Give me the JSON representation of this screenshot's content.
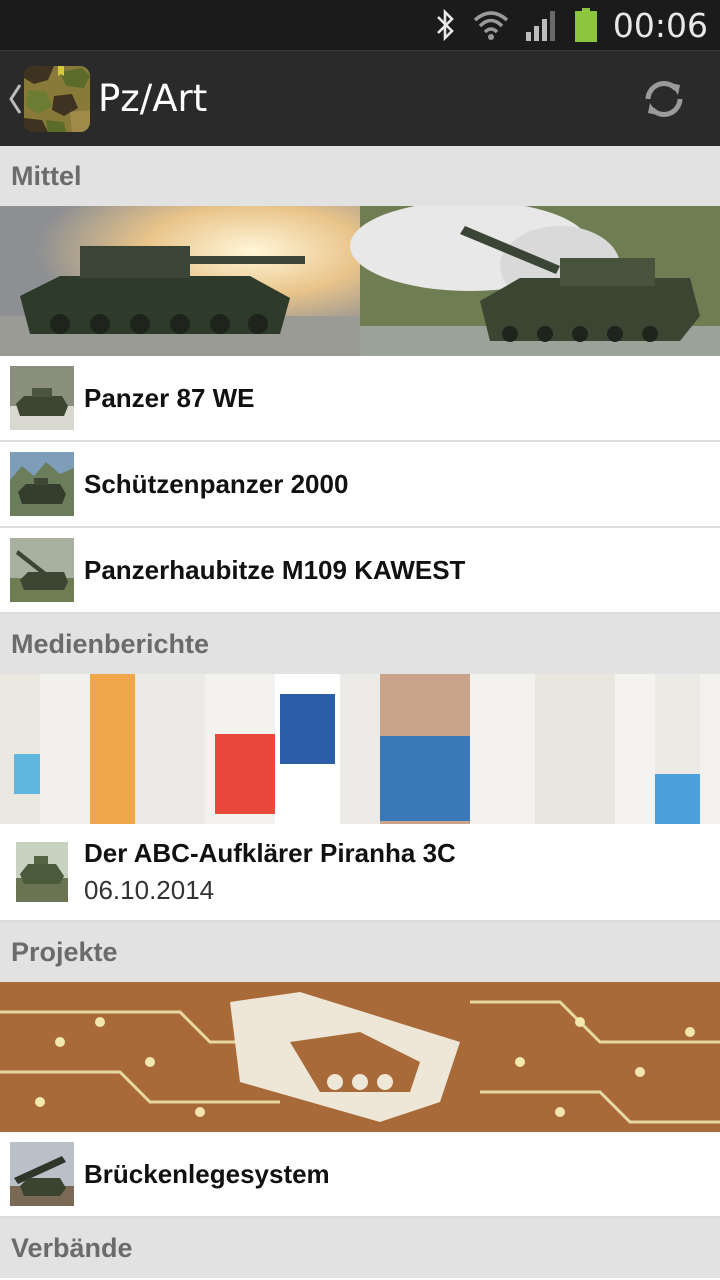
{
  "status_bar": {
    "time": "00:06",
    "icons": [
      "bluetooth-icon",
      "wifi-icon",
      "signal-icon",
      "battery-icon"
    ],
    "battery_color": "#8cc63f"
  },
  "action_bar": {
    "title": "Pz/Art",
    "icons": [
      "back-caret-icon",
      "app-camo-icon",
      "refresh-icon"
    ]
  },
  "sections": [
    {
      "header": "Mittel",
      "banner": "tanks-banner-image",
      "items": [
        {
          "title": "Panzer 87 WE",
          "thumb": "tank-thumb"
        },
        {
          "title": "Schützenpanzer 2000",
          "thumb": "ifv-thumb"
        },
        {
          "title": "Panzerhaubitze M109 KAWEST",
          "thumb": "howitzer-thumb"
        }
      ]
    },
    {
      "header": "Medienberichte",
      "banner": "newspapers-banner-image",
      "items": [
        {
          "title": "Der ABC-Aufklärer Piranha 3C",
          "date": "06.10.2014",
          "thumb": "piranha-thumb"
        }
      ]
    },
    {
      "header": "Projekte",
      "banner": "circuit-board-banner-image",
      "items": [
        {
          "title": "Brückenlegesystem",
          "thumb": "bridge-layer-thumb"
        }
      ]
    },
    {
      "header": "Verbände"
    }
  ],
  "colors": {
    "header_bg": "#e2e2e2",
    "header_text": "#6b6b6b",
    "action_bar_bg": "#2a2a2a",
    "status_bar_bg": "#1b1b1b"
  }
}
